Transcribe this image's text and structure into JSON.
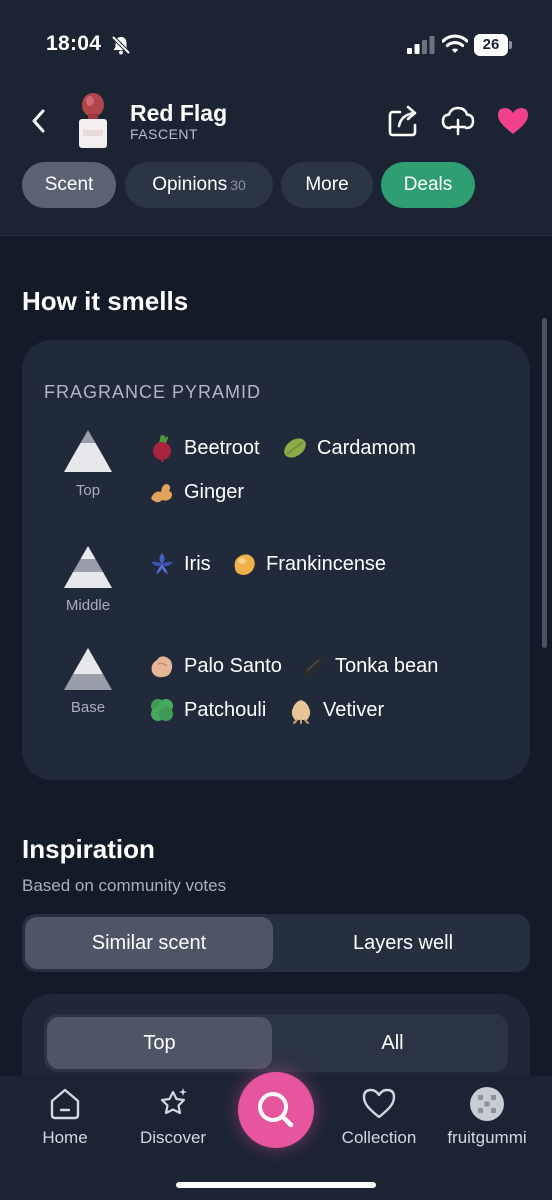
{
  "status_bar": {
    "time": "18:04",
    "battery": "26"
  },
  "header": {
    "product_name": "Red Flag",
    "brand": "FASCENT",
    "tabs": [
      {
        "label": "Scent",
        "count": ""
      },
      {
        "label": "Opinions",
        "count": "30"
      },
      {
        "label": "More",
        "count": ""
      },
      {
        "label": "Deals",
        "count": ""
      }
    ],
    "active_tab": "Scent",
    "accent_colors": {
      "deals": "#2f9e72",
      "favorite": "#f0418a",
      "search": "#e8559f"
    }
  },
  "smells": {
    "title": "How it smells",
    "pyramid_heading": "FRAGRANCE PYRAMID",
    "levels": [
      {
        "label": "Top",
        "notes": [
          {
            "name": "Beetroot",
            "icon": "beetroot-icon"
          },
          {
            "name": "Cardamom",
            "icon": "cardamom-icon"
          },
          {
            "name": "Ginger",
            "icon": "ginger-icon"
          }
        ]
      },
      {
        "label": "Middle",
        "notes": [
          {
            "name": "Iris",
            "icon": "iris-icon"
          },
          {
            "name": "Frankincense",
            "icon": "frankincense-icon"
          }
        ]
      },
      {
        "label": "Base",
        "notes": [
          {
            "name": "Palo Santo",
            "icon": "palo-santo-icon"
          },
          {
            "name": "Tonka bean",
            "icon": "tonka-bean-icon"
          },
          {
            "name": "Patchouli",
            "icon": "patchouli-icon"
          },
          {
            "name": "Vetiver",
            "icon": "vetiver-icon"
          }
        ]
      }
    ]
  },
  "inspiration": {
    "title": "Inspiration",
    "subtitle": "Based on community votes",
    "toggle": [
      "Similar scent",
      "Layers well"
    ],
    "toggle_active": "Similar scent",
    "filter": [
      "Top",
      "All"
    ],
    "filter_active": "Top"
  },
  "bottom_nav": [
    {
      "label": "Home",
      "icon": "home-icon"
    },
    {
      "label": "Discover",
      "icon": "discover-icon"
    },
    {
      "label": "",
      "icon": "search-icon"
    },
    {
      "label": "Collection",
      "icon": "heart-outline-icon"
    },
    {
      "label": "fruitgummi",
      "icon": "avatar"
    }
  ]
}
